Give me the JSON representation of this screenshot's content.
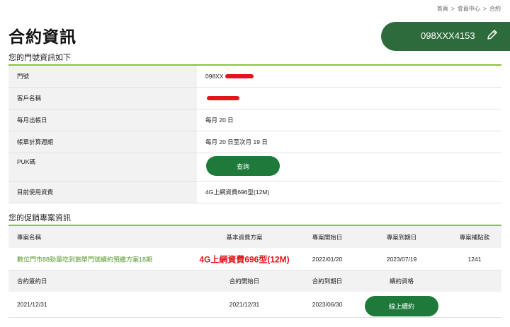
{
  "breadcrumb": {
    "home": "首頁",
    "member": "會員中心",
    "current": "合約",
    "sep": ">"
  },
  "page_title": "合約資訊",
  "phone_banner": {
    "number": "098XXX4153",
    "edit_icon": "pencil-icon"
  },
  "section1": {
    "title": "您的門號資訊如下",
    "rows": [
      {
        "label": "門號",
        "value": "098XX"
      },
      {
        "label": "客戶名稱",
        "value": ""
      },
      {
        "label": "每月出帳日",
        "value": "每月 20 日"
      },
      {
        "label": "帳單計算週期",
        "value": "每月 20 日至次月 19 日"
      },
      {
        "label": "PUK碼",
        "button": "查詢"
      },
      {
        "label": "目前使用資費",
        "value": "4G上網資費696型(12M)"
      }
    ]
  },
  "section2": {
    "title": "您的促銷專案資訊",
    "header1": [
      "專案名稱",
      "基本資費方案",
      "專案開始日",
      "專案到期日",
      "專案補貼款"
    ],
    "row1": {
      "name": "數位門市88勁量吃到飽單門號續約預繳方案18期",
      "plan": "4G上網資費696型(12M)",
      "start": "2022/01/20",
      "end": "2023/07/19",
      "subsidy": "1241"
    },
    "header2": [
      "合約簽約日",
      "合約開始日",
      "合約到期日",
      "續約資格"
    ],
    "row2": {
      "sign": "2021/12/31",
      "start": "2021/12/31",
      "end": "2023/06/30",
      "button": "線上續約"
    }
  },
  "colors": {
    "accent_green": "#2e6b3b",
    "button_green": "#1e7a3b",
    "line_green": "#8cc23f",
    "promo_text": "#5a9a2f",
    "plan_red": "#e4141b"
  }
}
